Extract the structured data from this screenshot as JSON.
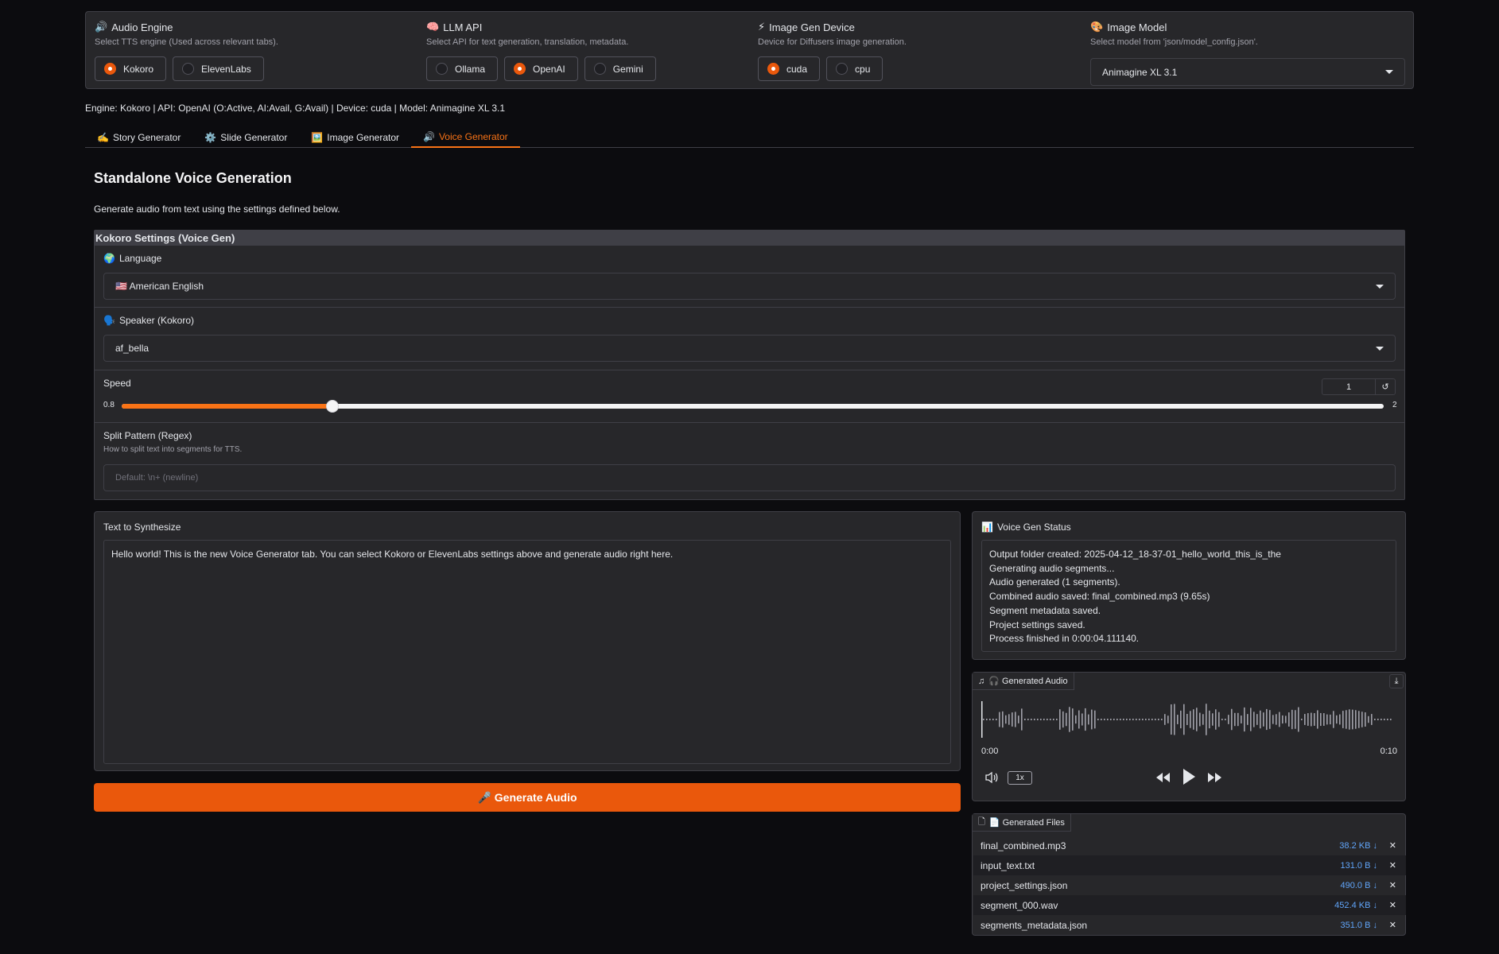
{
  "top": {
    "audio_engine": {
      "title": "Audio Engine",
      "icon": "speaker-icon",
      "subtitle": "Select TTS engine (Used across relevant tabs).",
      "options": [
        "Kokoro",
        "ElevenLabs"
      ],
      "selected": "Kokoro"
    },
    "llm_api": {
      "title": "LLM API",
      "icon": "brain-icon",
      "subtitle": "Select API for text generation, translation, metadata.",
      "options": [
        "Ollama",
        "OpenAI",
        "Gemini"
      ],
      "selected": "OpenAI"
    },
    "image_device": {
      "title": "Image Gen Device",
      "icon": "lightning-icon",
      "subtitle": "Device for Diffusers image generation.",
      "options": [
        "cuda",
        "cpu"
      ],
      "selected": "cuda"
    },
    "image_model": {
      "title": "Image Model",
      "icon": "palette-icon",
      "subtitle": "Select model from 'json/model_config.json'.",
      "value": "Animagine XL 3.1"
    }
  },
  "status_line": "Engine: Kokoro | API: OpenAI (O:Active, AI:Avail, G:Avail) | Device: cuda | Model: Animagine XL 3.1",
  "tabs": [
    {
      "label": "Story Generator",
      "icon": "writing-hand-icon"
    },
    {
      "label": "Slide Generator",
      "icon": "gear-icon"
    },
    {
      "label": "Image Generator",
      "icon": "picture-icon"
    },
    {
      "label": "Voice Generator",
      "icon": "speaker-icon",
      "active": true
    }
  ],
  "page": {
    "title": "Standalone Voice Generation",
    "description": "Generate audio from text using the settings defined below."
  },
  "kokoro": {
    "header": "Kokoro Settings (Voice Gen)",
    "language_label": "Language",
    "language_value": "🇺🇸 American English",
    "speaker_label": "Speaker (Kokoro)",
    "speaker_value": "af_bella",
    "speed_label": "Speed",
    "speed_value": "1",
    "speed_min": "0.8",
    "speed_max": "2",
    "speed_fraction": 0.1667,
    "split_label": "Split Pattern (Regex)",
    "split_info": "How to split text into segments for TTS.",
    "split_placeholder": "Default: \\n+ (newline)"
  },
  "synth": {
    "label": "Text to Synthesize",
    "value": "Hello world! This is the new Voice Generator tab. You can select Kokoro or ElevenLabs settings above and generate audio right here."
  },
  "generate_button": "🎤 Generate Audio",
  "status": {
    "label": "Voice Gen Status",
    "lines": [
      "Output folder created: 2025-04-12_18-37-01_hello_world_this_is_the",
      "Generating audio segments...",
      "Audio generated (1 segments).",
      "Combined audio saved: final_combined.mp3 (9.65s)",
      "Segment metadata saved.",
      "Project settings saved.",
      "Process finished in 0:00:04.111140."
    ]
  },
  "audio": {
    "label": "🎧 Generated Audio",
    "time_start": "0:00",
    "time_end": "0:10",
    "rate": "1x"
  },
  "files": {
    "label": "📄 Generated Files",
    "items": [
      {
        "name": "final_combined.mp3",
        "size": "38.2 KB ↓"
      },
      {
        "name": "input_text.txt",
        "size": "131.0 B ↓"
      },
      {
        "name": "project_settings.json",
        "size": "490.0 B ↓"
      },
      {
        "name": "segment_000.wav",
        "size": "452.4 KB ↓"
      },
      {
        "name": "segments_metadata.json",
        "size": "351.0 B ↓"
      }
    ]
  }
}
